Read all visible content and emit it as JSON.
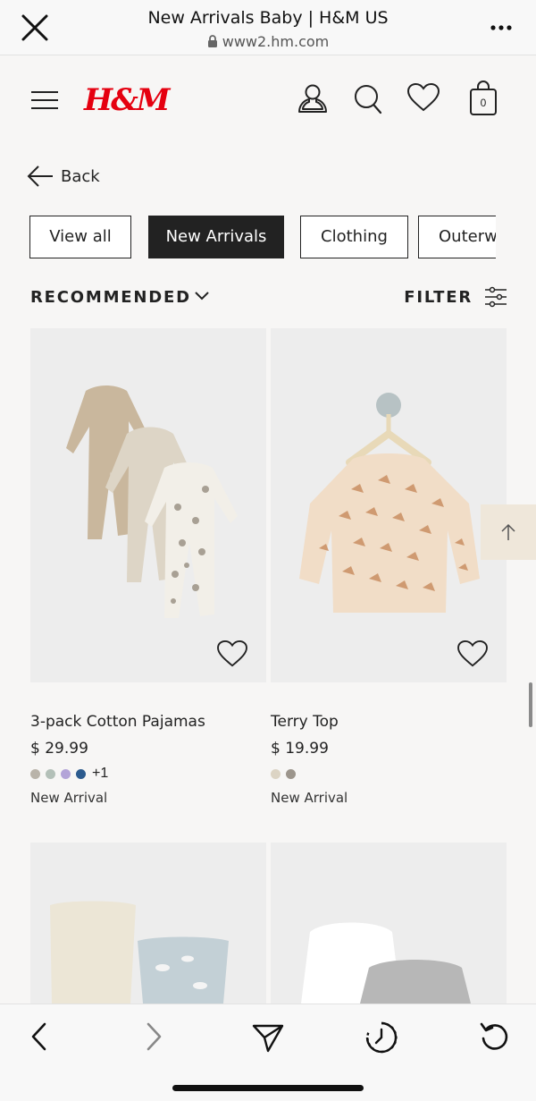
{
  "browser": {
    "title": "New Arrivals Baby | H&M US",
    "url": "www2.hm.com"
  },
  "header": {
    "logo": "H&M",
    "cart_count": "0"
  },
  "back_label": "Back",
  "chips": [
    {
      "label": "View all",
      "active": false
    },
    {
      "label": "New Arrivals",
      "active": true
    },
    {
      "label": "Clothing",
      "active": false
    },
    {
      "label": "Outerw",
      "active": false
    }
  ],
  "sort_label": "RECOMMENDED",
  "filter_label": "FILTER",
  "products": [
    {
      "name": "3-pack Cotton Pajamas",
      "price": "$ 29.99",
      "swatches": [
        "#b9b3a9",
        "#b3c0b8",
        "#b3a4d8",
        "#2c5b8e"
      ],
      "more_colors": "+1",
      "badge": "New Arrival"
    },
    {
      "name": "Terry Top",
      "price": "$ 19.99",
      "swatches": [
        "#dcd4c4",
        "#9c958c"
      ],
      "more_colors": "",
      "badge": "New Arrival"
    }
  ],
  "colors": {
    "brand_red": "#e50010",
    "active_chip_bg": "#222222",
    "scroll_top_bg": "#efe7da"
  }
}
